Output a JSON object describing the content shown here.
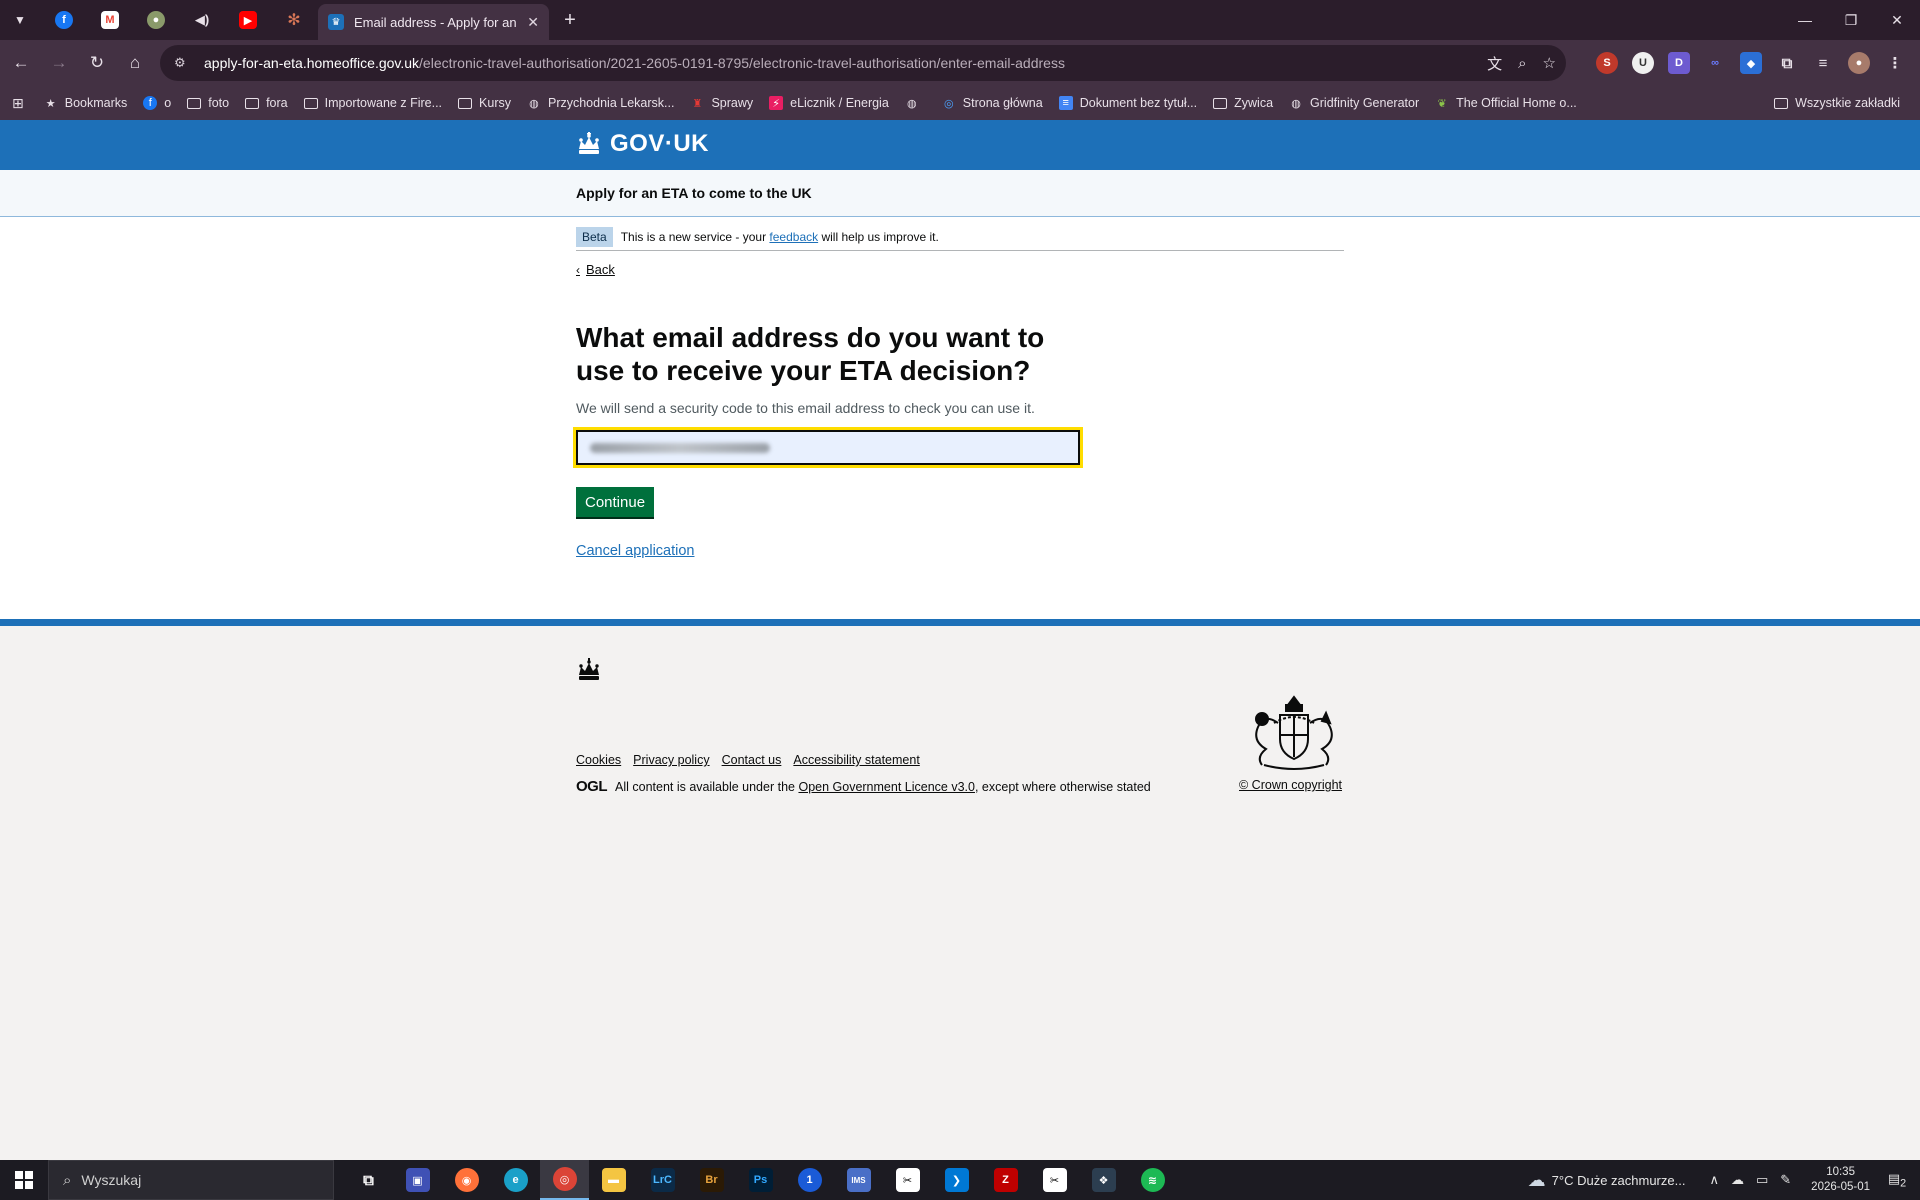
{
  "browser": {
    "active_tab_title": "Email address - Apply for an ETA",
    "url_host": "apply-for-an-eta.homeoffice.gov.uk",
    "url_path": "/electronic-travel-authorisation/2021-2605-0191-8795/electronic-travel-authorisation/enter-email-address",
    "bookmarks": [
      "Bookmarks",
      "o",
      "foto",
      "fora",
      "Importowane z Fire...",
      "Kursy",
      "Przychodnia Lekarsk...",
      "Sprawy",
      "eLicznik / Energia",
      "Strona główna",
      "Dokument bez tytuł...",
      "Zywica",
      "Gridfinity Generator",
      "The Official Home o..."
    ],
    "bookmarks_other": "Wszystkie zakładki"
  },
  "gov": {
    "logo_text": "GOV·UK",
    "service_name": "Apply for an ETA to come to the UK",
    "phase_tag": "Beta",
    "phase_text_before": "This is a new service - your",
    "phase_link": "feedback",
    "phase_text_after": "will help us improve it.",
    "back_label": "Back",
    "heading": "What email address do you want to use to receive your ETA decision?",
    "hint": "We will send a security code to this email address to check you can use it.",
    "email_value": "",
    "continue_label": "Continue",
    "cancel_label": "Cancel application"
  },
  "footer": {
    "links": [
      "Cookies",
      "Privacy policy",
      "Contact us",
      "Accessibility statement"
    ],
    "ogl_logo": "OGL",
    "licence_before": "All content is available under the",
    "licence_link": "Open Government Licence v3.0",
    "licence_after": ", except where otherwise stated",
    "crown_copyright": "© Crown copyright"
  },
  "taskbar": {
    "search_placeholder": "Wyszukaj",
    "weather": "7°C  Duże zachmurze...",
    "time": "10:35",
    "date": "2026-05-01",
    "notifications": "2"
  },
  "colors": {
    "gov_blue": "#1d70b8",
    "gov_green": "#00703c",
    "focus_yellow": "#ffdd00",
    "browser_frame": "#2b1d2b"
  }
}
